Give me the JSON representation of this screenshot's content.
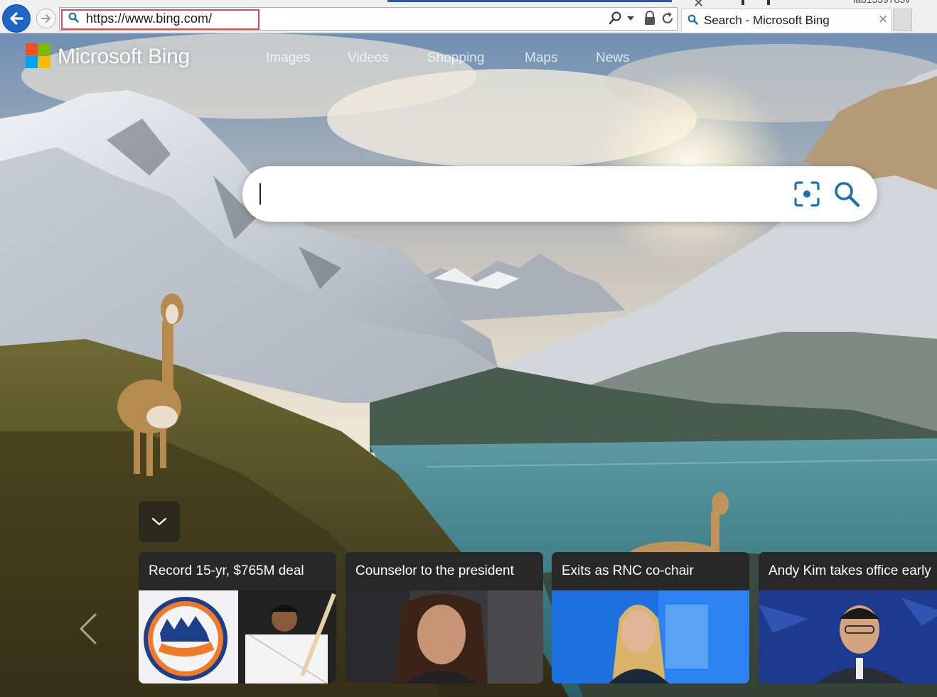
{
  "browser": {
    "address_url": "https://www.bing.com/",
    "tab_title": "Search - Microsoft Bing",
    "tab_close": "×",
    "top_right_text": "lab1339783v"
  },
  "bing": {
    "brand": "Microsoft Bing",
    "nav": [
      "Images",
      "Videos",
      "Shopping",
      "Maps",
      "News"
    ],
    "search_value": ""
  },
  "news_cards": [
    {
      "title": "Record 15-yr, $765M deal"
    },
    {
      "title": "Counselor to the president"
    },
    {
      "title": "Exits as RNC co-chair"
    },
    {
      "title": "Andy Kim takes office early"
    }
  ],
  "colors": {
    "ms_red": "#f25022",
    "ms_green": "#7fba00",
    "ms_blue": "#00a4ef",
    "ms_yellow": "#ffb900",
    "bing_accent": "#1b6fb5",
    "browser_back": "#1d66c8"
  },
  "icons": [
    "back-arrow-icon",
    "forward-arrow-icon",
    "search-icon",
    "lock-icon",
    "refresh-icon",
    "close-icon",
    "visual-search-icon",
    "chevron-down-icon",
    "chevron-left-icon"
  ]
}
